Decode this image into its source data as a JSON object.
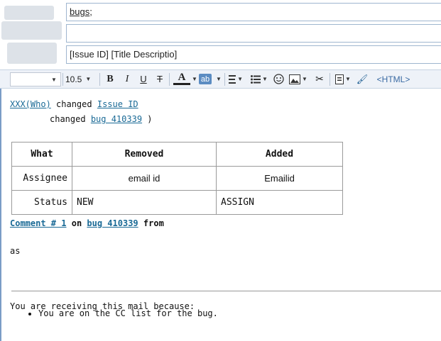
{
  "header": {
    "to_suffix": "bugs",
    "to_punct": ";",
    "cc_value": "",
    "subject": "[Issue ID] [Title Descriptio]"
  },
  "toolbar": {
    "font_size": "10.5",
    "bold": "B",
    "italic": "I",
    "underline": "U",
    "strike": "T",
    "font_color": "A",
    "highlight": "ab",
    "html_label": "<HTML>",
    "icons": [
      "bold-icon",
      "italic-icon",
      "underline-icon",
      "strikethrough-icon",
      "font-color-icon",
      "highlight-icon",
      "align-icon",
      "list-icon",
      "emoji-icon",
      "image-icon",
      "scissors-icon",
      "insert-icon",
      "format-painter-icon"
    ],
    "accent": "#7a9cc6"
  },
  "email": {
    "who_link": "XXX(Who)",
    "changed_word": "changed",
    "issue_link": "Issue ID ",
    "changed_word2": "changed",
    "bug_link": "bug 410339",
    "close_paren": ")",
    "table": {
      "headers": [
        "What",
        "Removed",
        "Added"
      ],
      "rows": [
        [
          "Assignee",
          "email id",
          "Emailid"
        ],
        [
          "Status",
          "NEW",
          "ASSIGN"
        ]
      ]
    },
    "comment_link": "Comment # 1",
    "on_word": "on",
    "comment_bug_link": "bug 410339",
    "from_word": "from",
    "comment_text": "as",
    "footer_intro": "You are receiving this mail because:",
    "footer_reasons": [
      "You are on the CC list for the bug."
    ]
  }
}
